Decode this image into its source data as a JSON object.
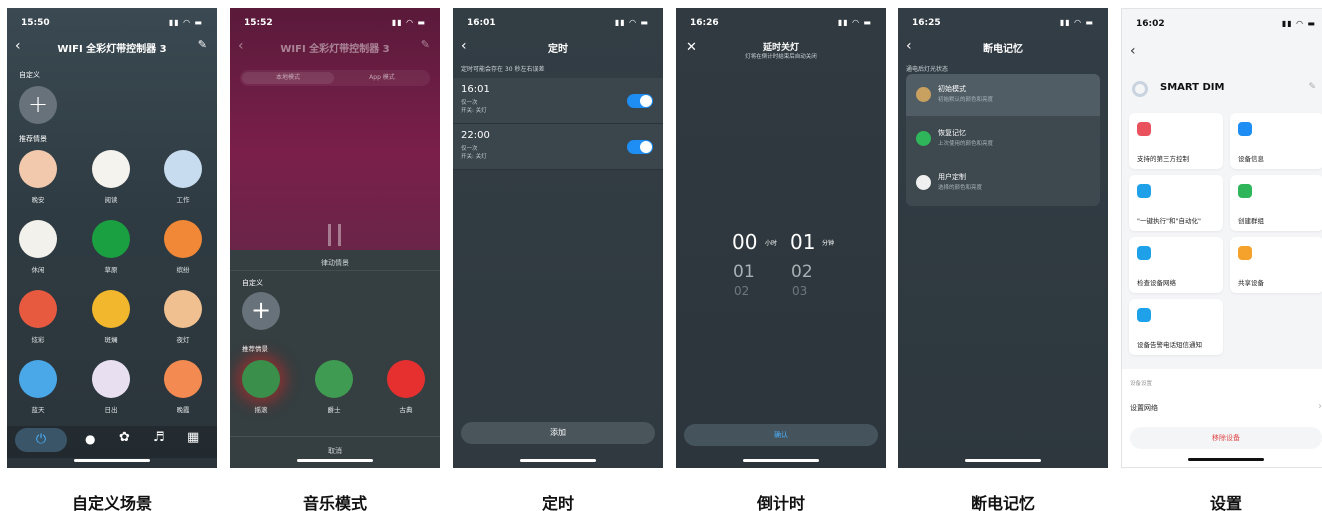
{
  "captions": [
    "自定义场景",
    "音乐模式",
    "定时",
    "倒计时",
    "断电记忆",
    "设置"
  ],
  "s1": {
    "time": "15:50",
    "title": "WIFI 全彩灯带控制器 3",
    "custom": "自定义",
    "recommend": "推荐情景",
    "scenes": [
      {
        "label": "晚安",
        "color": "#f2c9ad"
      },
      {
        "label": "阅读",
        "color": "#f5f3ee"
      },
      {
        "label": "工作",
        "color": "#c8dcf0"
      },
      {
        "label": "休闲",
        "color": "#f3f1ec"
      },
      {
        "label": "草原",
        "color": "#1aa040"
      },
      {
        "label": "缤纷",
        "color": "#f08838"
      },
      {
        "label": "炫彩",
        "color": "#e85a40"
      },
      {
        "label": "斑斓",
        "color": "#f2b72c"
      },
      {
        "label": "夜灯",
        "color": "#f0c090"
      },
      {
        "label": "蓝天",
        "color": "#4aa8e8"
      },
      {
        "label": "日出",
        "color": "#e8e0f0"
      },
      {
        "label": "晚霞",
        "color": "#f28a52"
      }
    ]
  },
  "s2": {
    "time": "15:52",
    "title": "WIFI 全彩灯带控制器 3",
    "tab_local": "本地模式",
    "tab_app": "App 模式",
    "rhythm": "律动情景",
    "custom": "自定义",
    "recommend": "推荐情景",
    "cancel": "取消",
    "scenes": [
      {
        "label": "摇滚",
        "color": "#3a8f4a"
      },
      {
        "label": "爵士",
        "color": "#3f9a52"
      },
      {
        "label": "古典",
        "color": "#e63030"
      }
    ]
  },
  "s3": {
    "time": "16:01",
    "title": "定时",
    "note": "定时可能会存在 30 秒左右误差",
    "add": "添加",
    "timers": [
      {
        "time": "16:01",
        "repeat": "仅一次",
        "action": "开关: 关灯"
      },
      {
        "time": "22:00",
        "repeat": "仅一次",
        "action": "开关: 关灯"
      }
    ]
  },
  "s4": {
    "time": "16:26",
    "title": "延时关灯",
    "subtitle": "灯将在倒计时结束后自动关闭",
    "hours": "00",
    "hour_unit": "小时",
    "minutes": "01",
    "min_unit": "分钟",
    "h2": "01",
    "m2": "02",
    "h3": "02",
    "m3": "03",
    "confirm": "确认"
  },
  "s5": {
    "time": "16:25",
    "title": "断电记忆",
    "section": "通电后灯光状态",
    "options": [
      {
        "title": "初始模式",
        "desc": "初始默认的颜色和亮度",
        "color": "#c8a060"
      },
      {
        "title": "恢复记忆",
        "desc": "上次使用的颜色和亮度",
        "color": "#2fb55a"
      },
      {
        "title": "用户定制",
        "desc": "选择的颜色和亮度",
        "color": "#f0f0f0"
      }
    ]
  },
  "s6": {
    "time": "16:02",
    "device": "SMART DIM",
    "cards": [
      {
        "label": "支持的第三方控制",
        "color": "#e9515c"
      },
      {
        "label": "设备信息",
        "color": "#1e8ef5"
      },
      {
        "label": "\"一键执行\"和\"自动化\"",
        "color": "#1ea1e8"
      },
      {
        "label": "创建群组",
        "color": "#2fb55a"
      },
      {
        "label": "检查设备网络",
        "color": "#1ea1e8"
      },
      {
        "label": "共享设备",
        "color": "#f4a22c"
      },
      {
        "label": "设备告警电话短信通知",
        "color": "#1ea1e8"
      }
    ],
    "section": "设备设置",
    "network": "设置网络",
    "remove": "移除设备"
  }
}
